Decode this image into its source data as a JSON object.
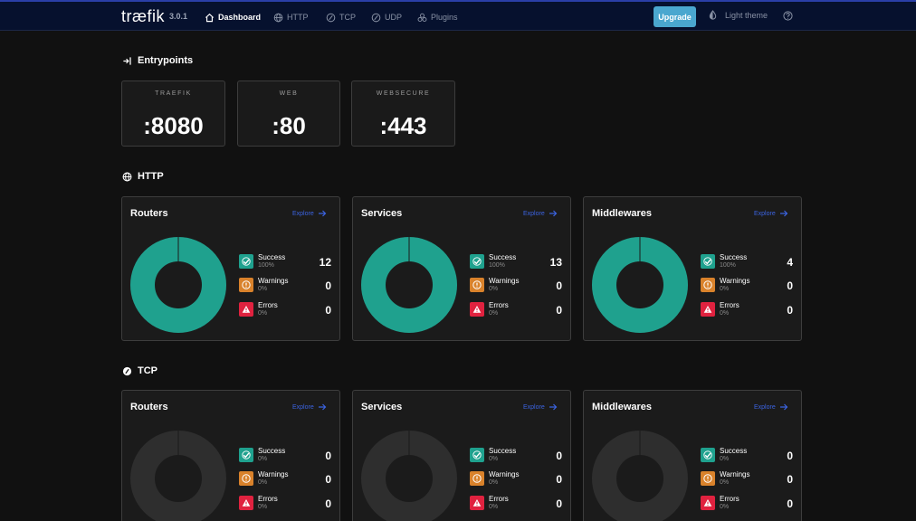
{
  "app": {
    "logo": "træfik",
    "version": "3.0.1"
  },
  "nav": {
    "items": [
      {
        "label": "Dashboard",
        "icon": "home-icon",
        "active": true
      },
      {
        "label": "HTTP",
        "icon": "globe-icon",
        "active": false
      },
      {
        "label": "TCP",
        "icon": "tcp-icon",
        "active": false
      },
      {
        "label": "UDP",
        "icon": "udp-icon",
        "active": false
      },
      {
        "label": "Plugins",
        "icon": "plugins-icon",
        "active": false
      }
    ],
    "upgrade_label": "Upgrade",
    "theme_label": "Light theme"
  },
  "entrypoints": {
    "title": "Entrypoints",
    "items": [
      {
        "name": "TRAEFIK",
        "port": ":8080"
      },
      {
        "name": "WEB",
        "port": ":80"
      },
      {
        "name": "WEBSECURE",
        "port": ":443"
      }
    ]
  },
  "http": {
    "title": "HTTP",
    "cards": [
      {
        "title": "Routers",
        "explore": "Explore",
        "success": {
          "label": "Success",
          "pct": "100%",
          "count": "12"
        },
        "warnings": {
          "label": "Warnings",
          "pct": "0%",
          "count": "0"
        },
        "errors": {
          "label": "Errors",
          "pct": "0%",
          "count": "0"
        }
      },
      {
        "title": "Services",
        "explore": "Explore",
        "success": {
          "label": "Success",
          "pct": "100%",
          "count": "13"
        },
        "warnings": {
          "label": "Warnings",
          "pct": "0%",
          "count": "0"
        },
        "errors": {
          "label": "Errors",
          "pct": "0%",
          "count": "0"
        }
      },
      {
        "title": "Middlewares",
        "explore": "Explore",
        "success": {
          "label": "Success",
          "pct": "100%",
          "count": "4"
        },
        "warnings": {
          "label": "Warnings",
          "pct": "0%",
          "count": "0"
        },
        "errors": {
          "label": "Errors",
          "pct": "0%",
          "count": "0"
        }
      }
    ]
  },
  "tcp": {
    "title": "TCP",
    "cards": [
      {
        "title": "Routers",
        "explore": "Explore",
        "success": {
          "label": "Success",
          "pct": "0%",
          "count": "0"
        },
        "warnings": {
          "label": "Warnings",
          "pct": "0%",
          "count": "0"
        },
        "errors": {
          "label": "Errors",
          "pct": "0%",
          "count": "0"
        }
      },
      {
        "title": "Services",
        "explore": "Explore",
        "success": {
          "label": "Success",
          "pct": "0%",
          "count": "0"
        },
        "warnings": {
          "label": "Warnings",
          "pct": "0%",
          "count": "0"
        },
        "errors": {
          "label": "Errors",
          "pct": "0%",
          "count": "0"
        }
      },
      {
        "title": "Middlewares",
        "explore": "Explore",
        "success": {
          "label": "Success",
          "pct": "0%",
          "count": "0"
        },
        "warnings": {
          "label": "Warnings",
          "pct": "0%",
          "count": "0"
        },
        "errors": {
          "label": "Errors",
          "pct": "0%",
          "count": "0"
        }
      }
    ]
  },
  "colors": {
    "success": "#1fa18e",
    "warning": "#d9822b",
    "error": "#e0223f",
    "donut_empty": "#2e2e2e",
    "accent": "#4aa7cf",
    "link": "#3b63e0"
  }
}
